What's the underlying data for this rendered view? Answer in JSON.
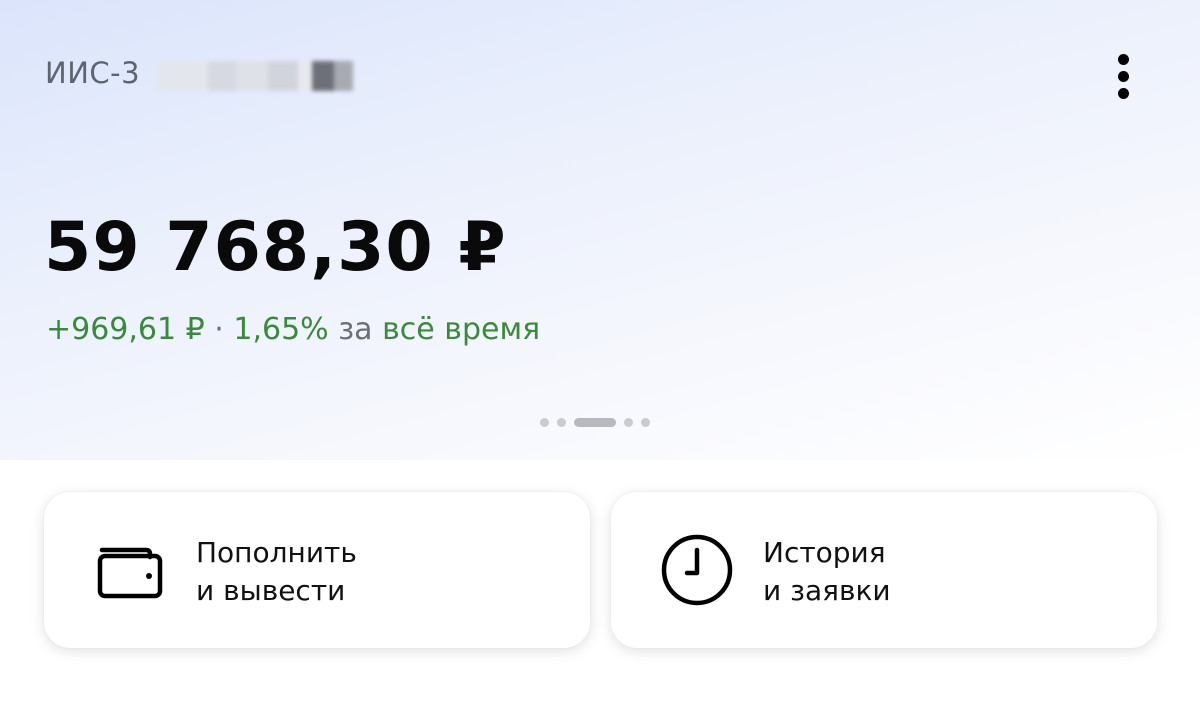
{
  "account": {
    "name": "ИИС-3",
    "more_icon": "more-vertical-icon"
  },
  "balance": {
    "amount": "59 768,30 ₽"
  },
  "profit": {
    "value": "+969,61 ₽",
    "separator": "·",
    "percent": "1,65%",
    "period_prefix": "за",
    "period": "всё время",
    "positive_color": "#3a8a3c"
  },
  "pager": {
    "pages": 5,
    "active_index": 2
  },
  "actions": [
    {
      "line1": "Пополнить",
      "line2": "и вывести",
      "icon": "wallet-icon"
    },
    {
      "line1": "История",
      "line2": "и заявки",
      "icon": "clock-icon"
    }
  ]
}
